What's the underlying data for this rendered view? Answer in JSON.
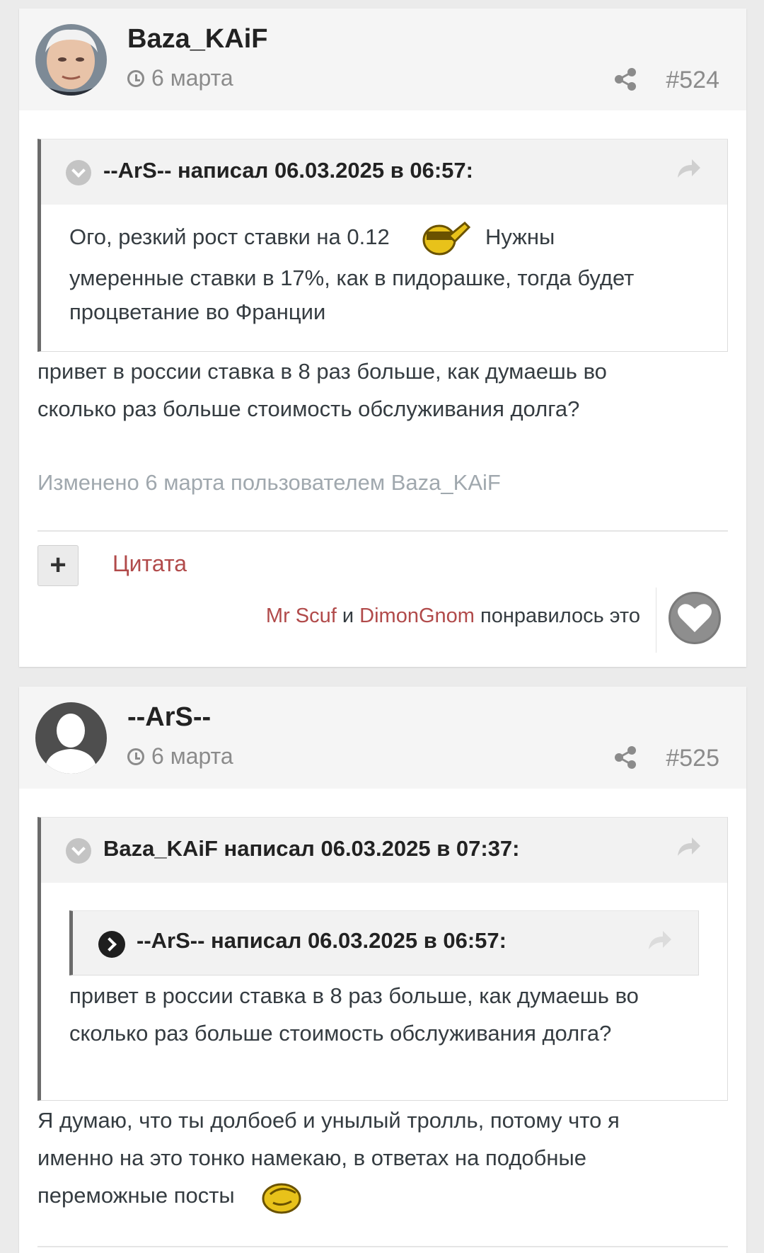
{
  "colors": {
    "link": "#b14a4a",
    "muted": "#8b8b8b",
    "text": "#353c41",
    "background": "#ebebeb"
  },
  "posts": [
    {
      "author": "Baza_KAiF",
      "date": "6 марта",
      "number": "#524",
      "quote": {
        "header": "--ArS-- написал 06.03.2025 в 06:57:",
        "line1": "Ого, резкий рост ставки на 0.12",
        "line1b": "Нужны",
        "line2": "умеренные ставки в 17%, как в пидорашке, тогда будет",
        "line3": "процветание во Франции"
      },
      "body_line1": "привет в россии ставка в 8 раз больше, как думаешь во",
      "body_line2": "сколько раз больше стоимость обслуживания долга?",
      "edited": "Изменено 6 марта пользователем Baza_KAiF",
      "quote_label": "Цитата",
      "plus_label": "+",
      "likes": {
        "user1": "Mr Scuf",
        "and": "и",
        "user2": "DimonGnom",
        "suffix": "понравилось это"
      }
    },
    {
      "author": "--ArS--",
      "date": "6 марта",
      "number": "#525",
      "quote": {
        "header": "Baza_KAiF написал 06.03.2025 в 07:37:",
        "nested_header": "--ArS-- написал 06.03.2025 в 06:57:",
        "line1": "привет в россии ставка в 8 раз больше, как думаешь во",
        "line2": "сколько раз больше стоимость обслуживания долга?"
      },
      "body_line1": "Я думаю, что ты долбоеб и унылый тролль, потому что я",
      "body_line2": "именно на это тонко намекаю, в ответах на подобные",
      "body_line3": "переможные посты"
    }
  ]
}
